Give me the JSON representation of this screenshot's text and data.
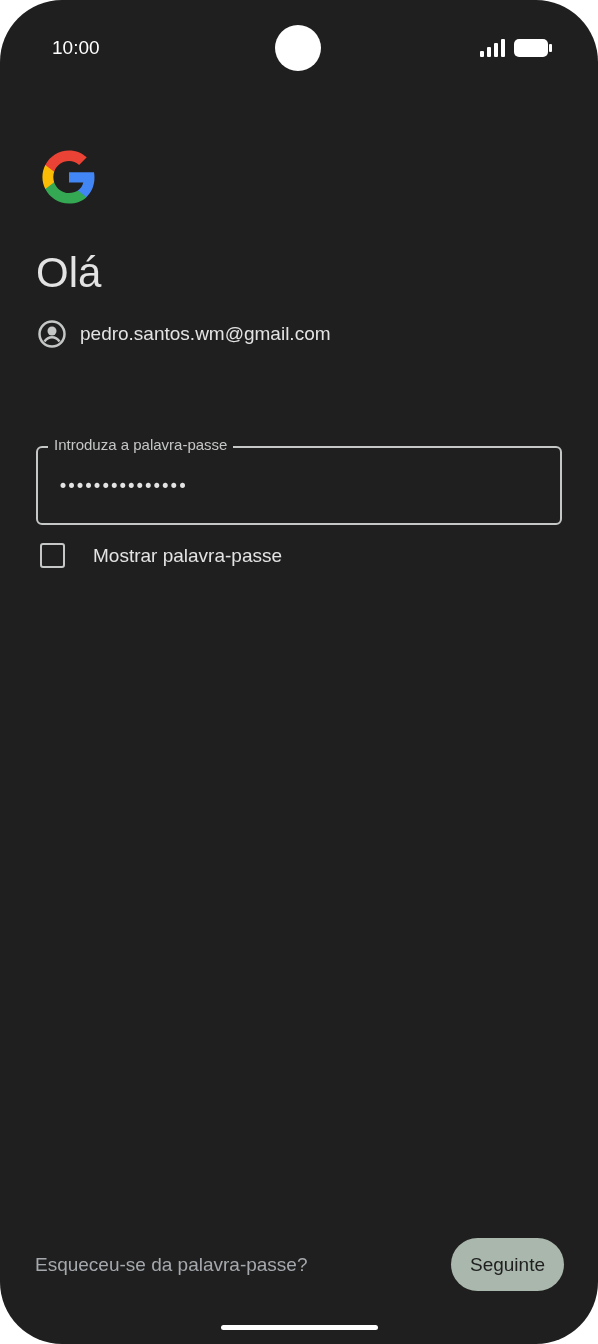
{
  "status_bar": {
    "time": "10:00"
  },
  "title": "Olá",
  "account": {
    "email": "pedro.santos.wm@gmail.com"
  },
  "password_field": {
    "label": "Introduza a palavra-passe",
    "value": "•••••••••••••••"
  },
  "show_password": {
    "label": "Mostrar palavra-passe",
    "checked": false
  },
  "forgot_link": "Esqueceu-se da palavra-passe?",
  "next_button": {
    "label": "Seguinte"
  }
}
